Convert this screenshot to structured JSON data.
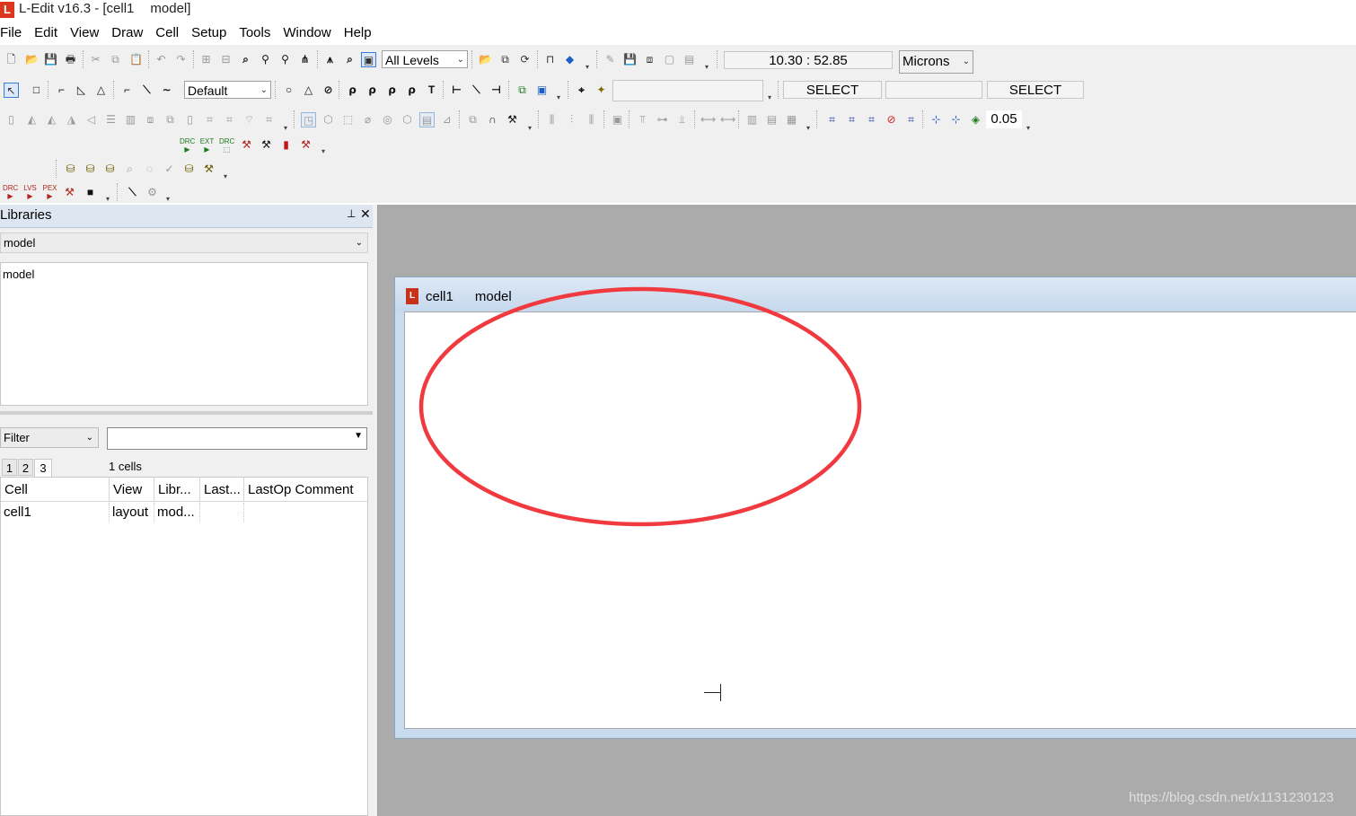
{
  "app": {
    "title_app": "L-Edit v16.3 - [cell1",
    "title_view": "model]",
    "logo_text": "L"
  },
  "menu": [
    "File",
    "Edit",
    "View",
    "Draw",
    "Cell",
    "Setup",
    "Tools",
    "Window",
    "Help"
  ],
  "toolbar": {
    "levels_select": "All Levels",
    "coordinates": "10.30 : 52.85",
    "units_select": "Microns",
    "layer_select": "Default",
    "mouse_left_mode": "SELECT",
    "mouse_right_mode": "SELECT",
    "grid_value": "0.05",
    "verification_labels": [
      "DRC",
      "EXT",
      "DRC",
      "DRC",
      "LVS",
      "PEX"
    ]
  },
  "libraries_pane": {
    "title": "Libraries",
    "selected_library": "model",
    "library_list": [
      "model"
    ],
    "filter_label": "Filter",
    "filter_value": "",
    "tabs": [
      "1",
      "2",
      "3"
    ],
    "active_tab": "3",
    "cells_count": "1 cells",
    "table": {
      "columns": [
        "Cell",
        "View",
        "Libr...",
        "Last...",
        "LastOp Comment"
      ],
      "rows": [
        [
          "cell1",
          "layout",
          "mod...",
          "",
          ""
        ]
      ]
    }
  },
  "document_window": {
    "cell_name": "cell1",
    "view_name": "model",
    "icon_letter": "L"
  },
  "annotation": {
    "color": "#f03a3f",
    "shape": "ellipse"
  },
  "watermark": "https://blog.csdn.net/x1131230123"
}
